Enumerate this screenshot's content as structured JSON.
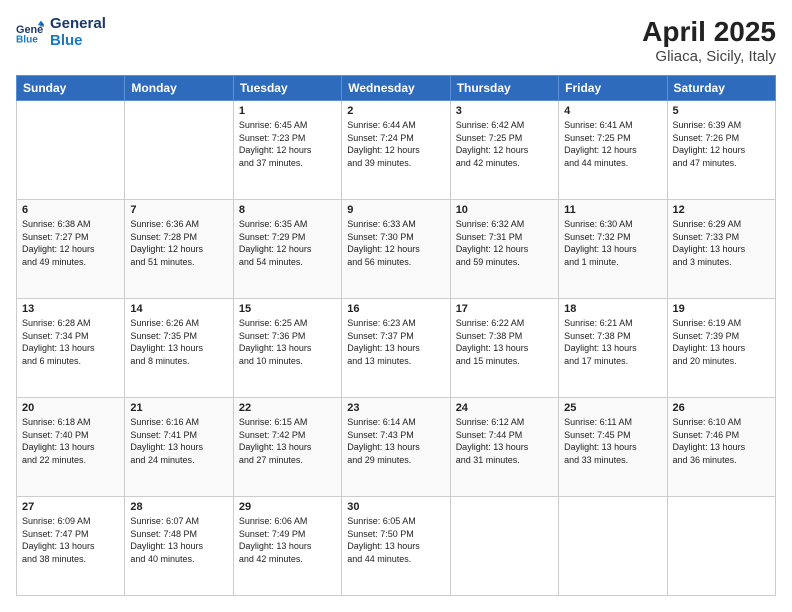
{
  "header": {
    "logo_line1": "General",
    "logo_line2": "Blue",
    "title": "April 2025",
    "subtitle": "Gliaca, Sicily, Italy"
  },
  "weekdays": [
    "Sunday",
    "Monday",
    "Tuesday",
    "Wednesday",
    "Thursday",
    "Friday",
    "Saturday"
  ],
  "weeks": [
    [
      {
        "day": "",
        "info": ""
      },
      {
        "day": "",
        "info": ""
      },
      {
        "day": "1",
        "info": "Sunrise: 6:45 AM\nSunset: 7:23 PM\nDaylight: 12 hours\nand 37 minutes."
      },
      {
        "day": "2",
        "info": "Sunrise: 6:44 AM\nSunset: 7:24 PM\nDaylight: 12 hours\nand 39 minutes."
      },
      {
        "day": "3",
        "info": "Sunrise: 6:42 AM\nSunset: 7:25 PM\nDaylight: 12 hours\nand 42 minutes."
      },
      {
        "day": "4",
        "info": "Sunrise: 6:41 AM\nSunset: 7:25 PM\nDaylight: 12 hours\nand 44 minutes."
      },
      {
        "day": "5",
        "info": "Sunrise: 6:39 AM\nSunset: 7:26 PM\nDaylight: 12 hours\nand 47 minutes."
      }
    ],
    [
      {
        "day": "6",
        "info": "Sunrise: 6:38 AM\nSunset: 7:27 PM\nDaylight: 12 hours\nand 49 minutes."
      },
      {
        "day": "7",
        "info": "Sunrise: 6:36 AM\nSunset: 7:28 PM\nDaylight: 12 hours\nand 51 minutes."
      },
      {
        "day": "8",
        "info": "Sunrise: 6:35 AM\nSunset: 7:29 PM\nDaylight: 12 hours\nand 54 minutes."
      },
      {
        "day": "9",
        "info": "Sunrise: 6:33 AM\nSunset: 7:30 PM\nDaylight: 12 hours\nand 56 minutes."
      },
      {
        "day": "10",
        "info": "Sunrise: 6:32 AM\nSunset: 7:31 PM\nDaylight: 12 hours\nand 59 minutes."
      },
      {
        "day": "11",
        "info": "Sunrise: 6:30 AM\nSunset: 7:32 PM\nDaylight: 13 hours\nand 1 minute."
      },
      {
        "day": "12",
        "info": "Sunrise: 6:29 AM\nSunset: 7:33 PM\nDaylight: 13 hours\nand 3 minutes."
      }
    ],
    [
      {
        "day": "13",
        "info": "Sunrise: 6:28 AM\nSunset: 7:34 PM\nDaylight: 13 hours\nand 6 minutes."
      },
      {
        "day": "14",
        "info": "Sunrise: 6:26 AM\nSunset: 7:35 PM\nDaylight: 13 hours\nand 8 minutes."
      },
      {
        "day": "15",
        "info": "Sunrise: 6:25 AM\nSunset: 7:36 PM\nDaylight: 13 hours\nand 10 minutes."
      },
      {
        "day": "16",
        "info": "Sunrise: 6:23 AM\nSunset: 7:37 PM\nDaylight: 13 hours\nand 13 minutes."
      },
      {
        "day": "17",
        "info": "Sunrise: 6:22 AM\nSunset: 7:38 PM\nDaylight: 13 hours\nand 15 minutes."
      },
      {
        "day": "18",
        "info": "Sunrise: 6:21 AM\nSunset: 7:38 PM\nDaylight: 13 hours\nand 17 minutes."
      },
      {
        "day": "19",
        "info": "Sunrise: 6:19 AM\nSunset: 7:39 PM\nDaylight: 13 hours\nand 20 minutes."
      }
    ],
    [
      {
        "day": "20",
        "info": "Sunrise: 6:18 AM\nSunset: 7:40 PM\nDaylight: 13 hours\nand 22 minutes."
      },
      {
        "day": "21",
        "info": "Sunrise: 6:16 AM\nSunset: 7:41 PM\nDaylight: 13 hours\nand 24 minutes."
      },
      {
        "day": "22",
        "info": "Sunrise: 6:15 AM\nSunset: 7:42 PM\nDaylight: 13 hours\nand 27 minutes."
      },
      {
        "day": "23",
        "info": "Sunrise: 6:14 AM\nSunset: 7:43 PM\nDaylight: 13 hours\nand 29 minutes."
      },
      {
        "day": "24",
        "info": "Sunrise: 6:12 AM\nSunset: 7:44 PM\nDaylight: 13 hours\nand 31 minutes."
      },
      {
        "day": "25",
        "info": "Sunrise: 6:11 AM\nSunset: 7:45 PM\nDaylight: 13 hours\nand 33 minutes."
      },
      {
        "day": "26",
        "info": "Sunrise: 6:10 AM\nSunset: 7:46 PM\nDaylight: 13 hours\nand 36 minutes."
      }
    ],
    [
      {
        "day": "27",
        "info": "Sunrise: 6:09 AM\nSunset: 7:47 PM\nDaylight: 13 hours\nand 38 minutes."
      },
      {
        "day": "28",
        "info": "Sunrise: 6:07 AM\nSunset: 7:48 PM\nDaylight: 13 hours\nand 40 minutes."
      },
      {
        "day": "29",
        "info": "Sunrise: 6:06 AM\nSunset: 7:49 PM\nDaylight: 13 hours\nand 42 minutes."
      },
      {
        "day": "30",
        "info": "Sunrise: 6:05 AM\nSunset: 7:50 PM\nDaylight: 13 hours\nand 44 minutes."
      },
      {
        "day": "",
        "info": ""
      },
      {
        "day": "",
        "info": ""
      },
      {
        "day": "",
        "info": ""
      }
    ]
  ]
}
